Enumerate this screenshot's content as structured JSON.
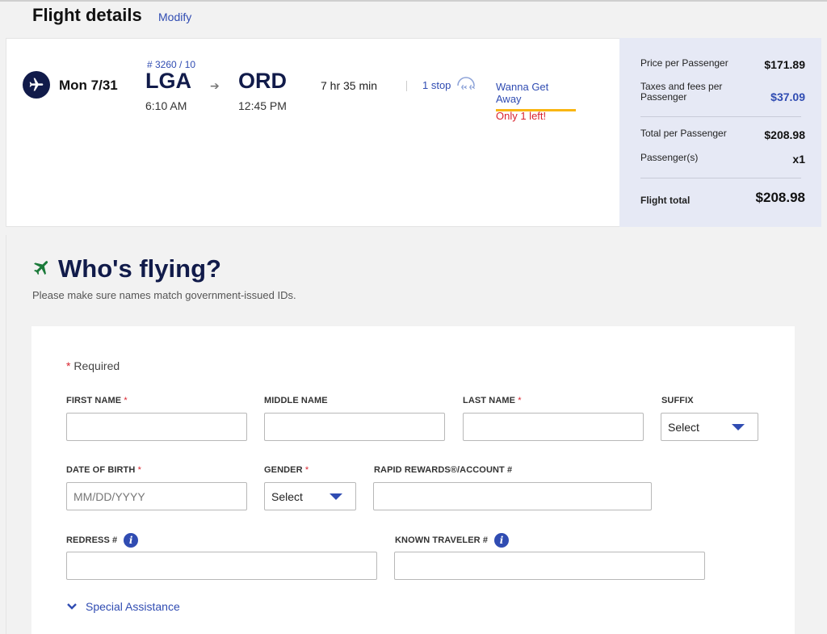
{
  "flight_details": {
    "title": "Flight details",
    "modify_label": "Modify"
  },
  "flight": {
    "date": "Mon 7/31",
    "flight_number": "# 3260 / 10",
    "origin_code": "LGA",
    "origin_time": "6:10 AM",
    "destination_code": "ORD",
    "destination_time": "12:45 PM",
    "duration": "7 hr 35 min",
    "stops": "1 stop",
    "fare_type": "Wanna Get Away",
    "availability": "Only 1 left!"
  },
  "pricing": {
    "price_label": "Price per Passenger",
    "price_value": "$171.89",
    "taxes_label": "Taxes and fees per Passenger",
    "taxes_value": "$37.09",
    "total_label": "Total per Passenger",
    "total_value": "$208.98",
    "passengers_label": "Passenger(s)",
    "passengers_value": "x1",
    "flight_total_label": "Flight total",
    "flight_total_value": "$208.98"
  },
  "whos_flying": {
    "title": "Who's flying?",
    "subtitle": "Please make sure names match government-issued IDs."
  },
  "form": {
    "required_note": "Required",
    "first_name_label": "FIRST NAME",
    "middle_name_label": "MIDDLE NAME",
    "last_name_label": "LAST NAME",
    "suffix_label": "SUFFIX",
    "suffix_value": "Select",
    "dob_label": "DATE OF BIRTH",
    "dob_placeholder": "MM/DD/YYYY",
    "gender_label": "GENDER",
    "gender_value": "Select",
    "rapid_rewards_label": "RAPID REWARDS®/ACCOUNT #",
    "redress_label": "REDRESS #",
    "known_traveler_label": "KNOWN TRAVELER #",
    "special_assistance_label": "Special Assistance"
  },
  "colors": {
    "brand_blue": "#304cb2",
    "navy": "#111b4a",
    "required_red": "#d9232e",
    "fare_underline": "#f9b612",
    "plane_green": "#1b7a3a",
    "price_panel_bg": "#e6e9f5"
  }
}
